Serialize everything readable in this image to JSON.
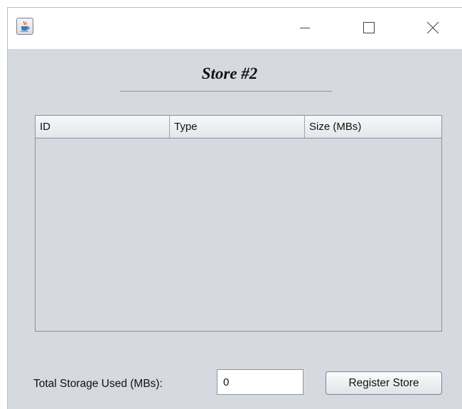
{
  "window": {
    "icon": "java-cup-icon",
    "controls": [
      "minimize-icon",
      "maximize-icon",
      "close-icon"
    ]
  },
  "store": {
    "title": "Store #2"
  },
  "table": {
    "columns": [
      "ID",
      "Type",
      "Size (MBs)"
    ],
    "rows": []
  },
  "footer": {
    "total_label": "Total Storage Used (MBs):",
    "total_value": "0",
    "register_label": "Register Store"
  }
}
